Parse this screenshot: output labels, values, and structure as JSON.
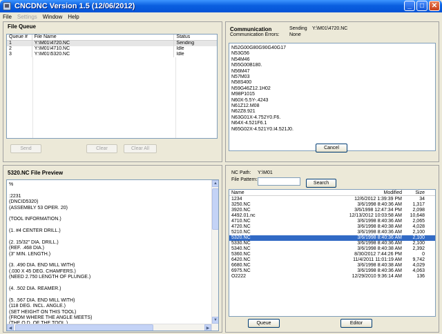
{
  "window": {
    "title": "CNCDNC Version 1.5  (12/06/2012)",
    "minimize": "_",
    "maximize": "□",
    "close": "✕"
  },
  "menu": [
    "File",
    "Settings",
    "Window",
    "Help"
  ],
  "file_queue": {
    "title": "File Queue",
    "columns": [
      "Queue #",
      "File Name",
      "Status"
    ],
    "rows": [
      {
        "num": "1",
        "name": "Y:\\M01\\4720.NC",
        "status": "Sending"
      },
      {
        "num": "2",
        "name": "Y:\\M01\\4710.NC",
        "status": "Idle"
      },
      {
        "num": "3",
        "name": "Y:\\M01\\5320.NC",
        "status": "Idle"
      }
    ],
    "buttons": {
      "send": "Send",
      "clear": "Clear",
      "clear_all": "Clear All"
    }
  },
  "communication": {
    "title": "Communication",
    "status_label": "Sending",
    "status_file": "Y:\\M01\\4720.NC",
    "errors_label": "Communication Errors:",
    "errors_value": "None",
    "lines": [
      "N52G00G80G90G40G17",
      "N53G56",
      "N54M46",
      "N55G00B180.",
      "N56M47",
      "N57M03",
      "N58S400",
      "N59G46Z12.1H02",
      "M98P1015",
      "N60X-5.5Y-.4243",
      "N61Z12.M08",
      "N62Z8.921",
      "N63G01X-4.752Y0.F6.",
      "N64X-4.521F6.1",
      "N65G02X-4.521Y0.I4.521J0."
    ],
    "cancel": "Cancel"
  },
  "preview": {
    "title": "5320.NC File Preview",
    "lines": [
      "%",
      "",
      ":2231",
      "(DNCID5320)",
      "(ASSEMBLY 53 OPER. 20)",
      "",
      "(TOOL INFORMATION.)",
      "",
      "(1. #4 CENTER DRILL.)",
      "",
      "(2. 15/32\" DIA. DRILL.)",
      "(REF. .468 DIA.)",
      "(3\" MIN. LENGTH.)",
      "",
      "(3. .490 DIA. END MILL WITH)",
      "(.030 X 45 DEG. CHAMFERS.)",
      "(NEED 2.750 LENGTH OF PLUNGE.)",
      "",
      "(4. .502 DIA. REAMER.)",
      "",
      "(5. .567 DIA. END MILL WITH)",
      "(118 DEG. INCL. ANGLE.)",
      "(SET HEIGHT ON THIS TOOL)",
      "(FROM WHERE THE ANGLE MEETS)",
      "(THE O.D. OF THE TOOL.)"
    ]
  },
  "browser": {
    "nc_path_label": "NC Path:",
    "nc_path_value": "Y:\\M01",
    "pattern_label": "File Pattern:",
    "pattern_value": "",
    "search": "Search",
    "columns": [
      "Name",
      "Modified",
      "Size"
    ],
    "files": [
      {
        "name": "1234",
        "modified": "12/6/2012 1:39:39 PM",
        "size": "34"
      },
      {
        "name": "3250.NC",
        "modified": "3/6/1998 8:40:36 AM",
        "size": "1,317"
      },
      {
        "name": "3920.NC",
        "modified": "3/6/1998 12:47:34 PM",
        "size": "2,098"
      },
      {
        "name": "4492.01.nc",
        "modified": "12/13/2012 10:03:58 AM",
        "size": "10,648"
      },
      {
        "name": "4710.NC",
        "modified": "3/6/1998 8:40:36 AM",
        "size": "2,065"
      },
      {
        "name": "4720.NC",
        "modified": "3/6/1998 8:40:38 AM",
        "size": "4,028"
      },
      {
        "name": "5210.NC",
        "modified": "3/6/1998 8:40:36 AM",
        "size": "2,100"
      },
      {
        "name": "5320.NC",
        "modified": "3/6/1998 8:40:36 AM",
        "size": "2,100",
        "selected": true
      },
      {
        "name": "5330.NC",
        "modified": "3/6/1998 8:40:36 AM",
        "size": "2,100"
      },
      {
        "name": "5340.NC",
        "modified": "3/6/1998 8:40:38 AM",
        "size": "2,392"
      },
      {
        "name": "5360.NC",
        "modified": "8/30/2012 7:44:26 PM",
        "size": "0"
      },
      {
        "name": "6420.NC",
        "modified": "11/4/2011 11:01:19 AM",
        "size": "9,742"
      },
      {
        "name": "6680.NC",
        "modified": "3/6/1998 8:40:38 AM",
        "size": "4,029"
      },
      {
        "name": "6975.NC",
        "modified": "3/6/1998 8:40:36 AM",
        "size": "4,063"
      },
      {
        "name": "O2222",
        "modified": "12/29/2010 9:36:14 AM",
        "size": "136"
      }
    ],
    "queue": "Queue",
    "editor": "Editor"
  }
}
